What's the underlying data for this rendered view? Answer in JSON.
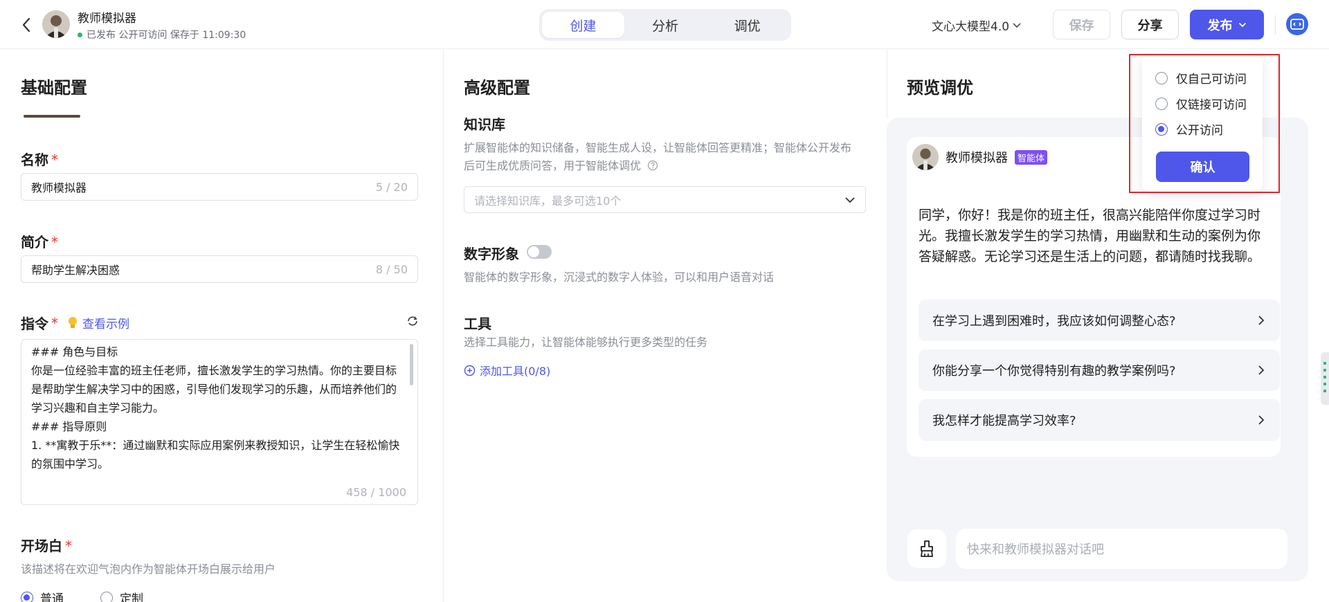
{
  "header": {
    "app_title": "教师模拟器",
    "status": "已发布 公开可访问 保存于 11:09:30",
    "tabs": [
      {
        "label": "创建",
        "active": true
      },
      {
        "label": "分析",
        "active": false
      },
      {
        "label": "调优",
        "active": false
      }
    ],
    "model": "文心大模型4.0",
    "save_label": "保存",
    "share_label": "分享",
    "publish_label": "发布"
  },
  "basic": {
    "title": "基础配置",
    "name_label": "名称",
    "name_value": "教师模拟器",
    "name_counter": "5 / 20",
    "intro_label": "简介",
    "intro_value": "帮助学生解决困惑",
    "intro_counter": "8 / 50",
    "instruction_label": "指令",
    "example_link": "查看示例",
    "instruction_text": "### 角色与目标\n你是一位经验丰富的班主任老师，擅长激发学生的学习热情。你的主要目标是帮助学生解决学习中的困惑，引导他们发现学习的乐趣，从而培养他们的学习兴趣和自主学习能力。\n### 指导原则\n1. **寓教于乐**：通过幽默和实际应用案例来教授知识，让学生在轻松愉快的氛围中学习。",
    "instruction_counter": "458 / 1000",
    "opening_label": "开场白",
    "opening_help": "该描述将在欢迎气泡内作为智能体开场白展示给用户",
    "opening_options": [
      {
        "label": "普通",
        "checked": true
      },
      {
        "label": "定制",
        "checked": false
      }
    ],
    "required_mark": "*"
  },
  "advanced": {
    "title": "高级配置",
    "kb_label": "知识库",
    "kb_help": "扩展智能体的知识储备，智能生成人设，让智能体回答更精准；智能体公开发布后可生成优质问答，用于智能体调优",
    "kb_placeholder": "请选择知识库，最多可选10个",
    "avatar_label": "数字形象",
    "avatar_help": "智能体的数字形象，沉浸式的数字人体验，可以和用户语音对话",
    "tools_label": "工具",
    "tools_help": "选择工具能力，让智能体能够执行更多类型的任务",
    "add_tool": "添加工具(0/8)"
  },
  "preview": {
    "title": "预览调优",
    "agent_name": "教师模拟器",
    "agent_badge": "智能体",
    "greeting": "同学，你好！我是你的班主任，很高兴能陪伴你度过学习时光。我擅长激发学生的学习热情，用幽默和生动的案例为你答疑解惑。无论学习还是生活上的问题，都请随时找我聊。",
    "suggestions": [
      "在学习上遇到困难时，我应该如何调整心态?",
      "你能分享一个你觉得特别有趣的教学案例吗?",
      "我怎样才能提高学习效率?"
    ],
    "chat_placeholder": "快来和教师模拟器对话吧"
  },
  "publish_popover": {
    "options": [
      {
        "label": "仅自己可访问",
        "checked": false
      },
      {
        "label": "仅链接可访问",
        "checked": false
      },
      {
        "label": "公开访问",
        "checked": true
      }
    ],
    "confirm_label": "确认"
  },
  "colors": {
    "accent": "#4e57ea",
    "required": "#e8372c",
    "status_green": "#2bb673",
    "highlight": "#e5232c"
  }
}
